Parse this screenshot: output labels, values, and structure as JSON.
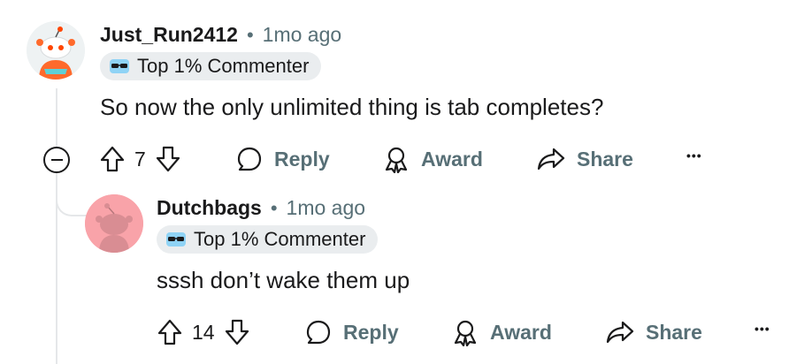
{
  "comment": {
    "username": "Just_Run2412",
    "separator": "•",
    "time": "1mo ago",
    "flair": "Top 1% Commenter",
    "body": "So now the only unlimited thing is tab completes?",
    "votes": "7",
    "reply_label": "Reply",
    "award_label": "Award",
    "share_label": "Share",
    "more_label": "•••"
  },
  "reply": {
    "username": "Dutchbags",
    "separator": "•",
    "time": "1mo ago",
    "flair": "Top 1% Commenter",
    "body": "sssh don’t wake them up",
    "votes": "14",
    "reply_label": "Reply",
    "award_label": "Award",
    "share_label": "Share",
    "more_label": "•••"
  },
  "colors": {
    "text": "#1a1a1b",
    "muted": "#576f76",
    "flair_bg": "#eaedef",
    "thread_line": "#e5e7e9",
    "avatar2_bg": "#f9a3a9"
  },
  "icons": [
    "snoo-avatar",
    "sunglasses-icon",
    "upvote-icon",
    "downvote-icon",
    "comment-icon",
    "award-icon",
    "share-icon",
    "collapse-icon"
  ]
}
